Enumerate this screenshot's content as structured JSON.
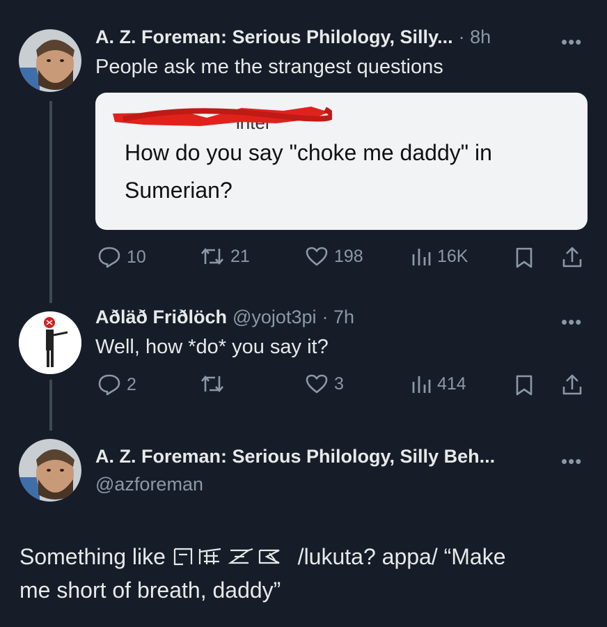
{
  "tweet1": {
    "name": "A. Z. Foreman: Serious Philology, Silly...",
    "time": "· 8h",
    "text": "People ask me the strangest questions",
    "quote": {
      "redacted_tail": "inter",
      "line1": "How do you say \"choke me daddy\" in",
      "line2": "Sumerian?"
    },
    "actions": {
      "replies": "10",
      "retweets": "21",
      "likes": "198",
      "views": "16K"
    }
  },
  "tweet2": {
    "name": "Aðläð Friðlöch",
    "handle": "@yojot3pi",
    "time": "· 7h",
    "text": "Well, how *do* you say it?",
    "actions": {
      "replies": "2",
      "likes": "3",
      "views": "414"
    }
  },
  "tweet3": {
    "name": "A. Z. Foreman: Serious Philology, Silly Beh...",
    "handle": "@azforeman",
    "text_before": "Something like",
    "text_after": "/lukuta? appa/ “Make",
    "text_line2": "me short of breath, daddy”"
  },
  "more_label": "•••",
  "colors": {
    "background": "#161d28",
    "muted": "#8b98a5",
    "text": "#e7e9ea",
    "redaction": "#e0221d"
  },
  "icons": [
    "reply-icon",
    "retweet-icon",
    "like-icon",
    "views-icon",
    "bookmark-icon",
    "share-icon",
    "more-icon"
  ]
}
